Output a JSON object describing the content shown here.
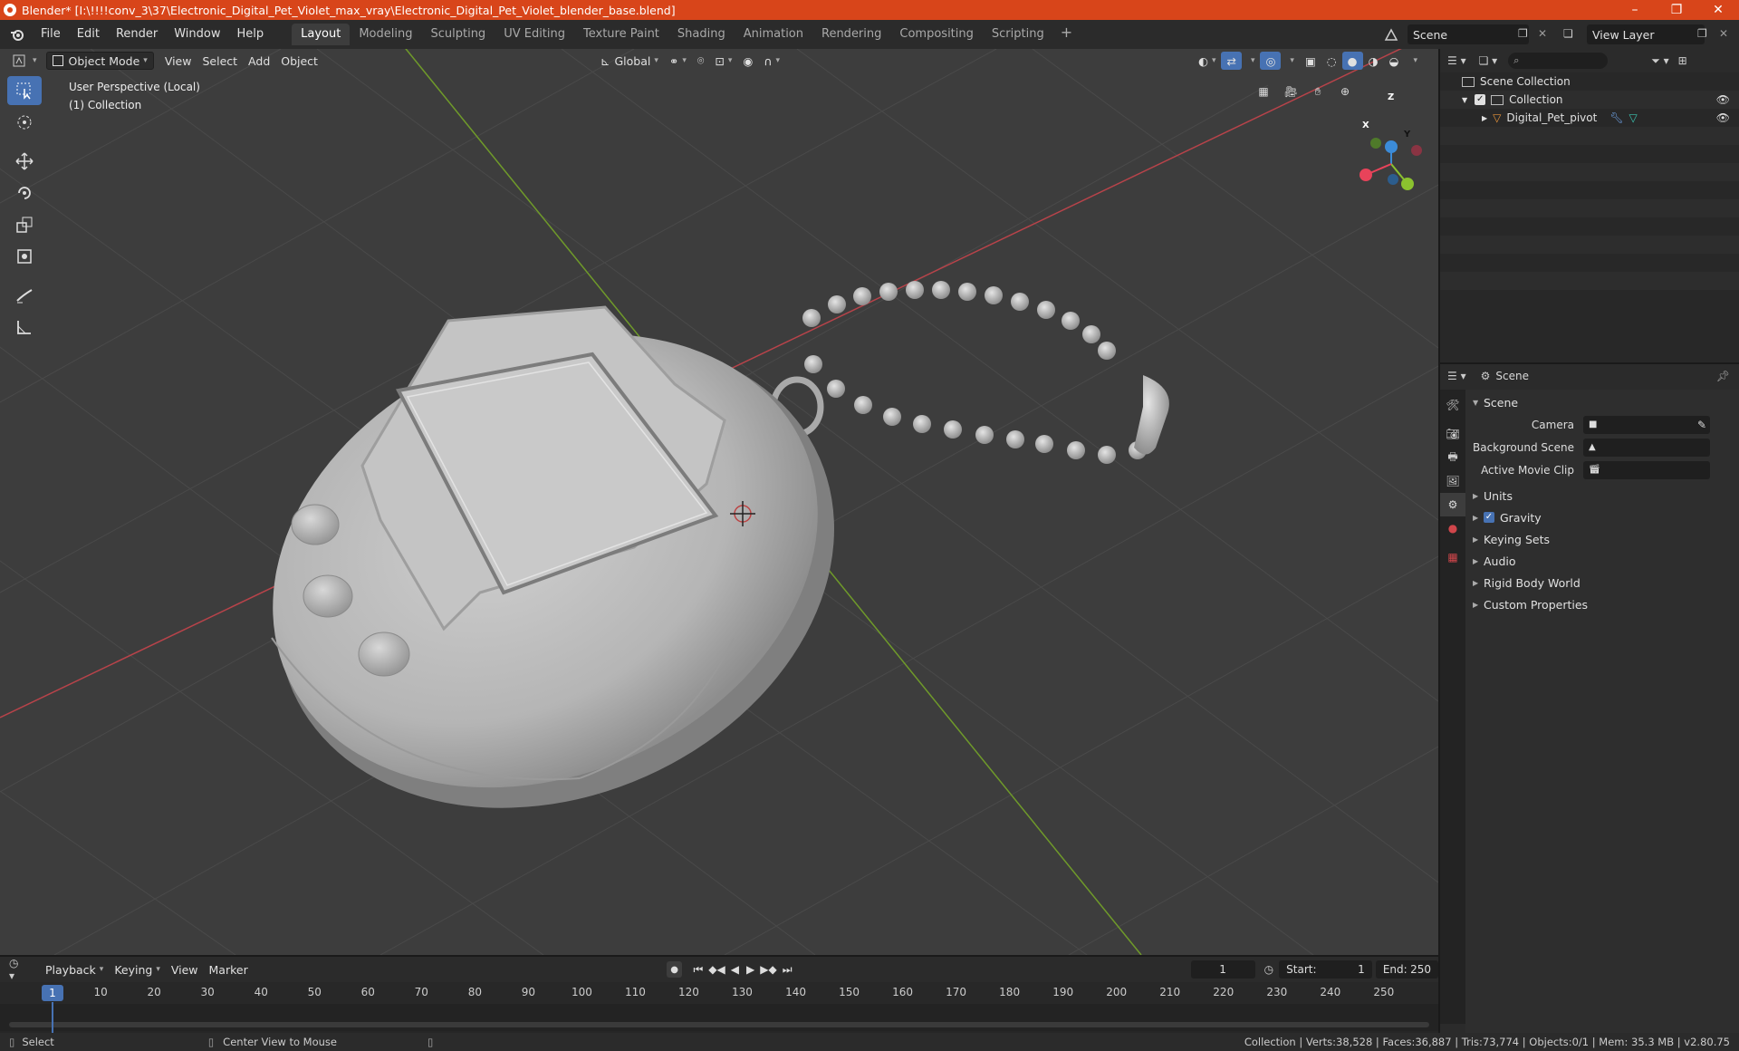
{
  "window": {
    "title": "Blender* [I:\\!!!!conv_3\\37\\Electronic_Digital_Pet_Violet_max_vray\\Electronic_Digital_Pet_Violet_blender_base.blend]",
    "minimize": "–",
    "maximize": "❐",
    "close": "✕"
  },
  "menu": [
    "File",
    "Edit",
    "Render",
    "Window",
    "Help"
  ],
  "workspaces": [
    "Layout",
    "Modeling",
    "Sculpting",
    "UV Editing",
    "Texture Paint",
    "Shading",
    "Animation",
    "Rendering",
    "Compositing",
    "Scripting"
  ],
  "workspace_add": "+",
  "scene_name": "Scene",
  "view_layer": "View Layer",
  "viewport": {
    "mode": "Object Mode",
    "menus": [
      "View",
      "Select",
      "Add",
      "Object"
    ],
    "orientation": "Global",
    "info_line1": "User Perspective (Local)",
    "info_line2": "(1) Collection",
    "gizmo": {
      "x": "X",
      "y": "Y",
      "z": "Z"
    }
  },
  "outliner": {
    "scene_collection": "Scene Collection",
    "collection": "Collection",
    "object": "Digital_Pet_pivot"
  },
  "properties": {
    "context": "Scene",
    "panel_scene": "Scene",
    "camera_label": "Camera",
    "background_scene_label": "Background Scene",
    "active_movie_clip_label": "Active Movie Clip",
    "panels": [
      "Units",
      "Gravity",
      "Keying Sets",
      "Audio",
      "Rigid Body World",
      "Custom Properties"
    ]
  },
  "timeline": {
    "menus": [
      "Playback",
      "Keying",
      "View",
      "Marker"
    ],
    "current_frame": "1",
    "start_label": "Start:",
    "start": "1",
    "end_label": "End:",
    "end": "250",
    "ticks": [
      "1",
      "10",
      "20",
      "30",
      "40",
      "50",
      "60",
      "70",
      "80",
      "90",
      "100",
      "110",
      "120",
      "130",
      "140",
      "150",
      "160",
      "170",
      "180",
      "190",
      "200",
      "210",
      "220",
      "230",
      "240",
      "250"
    ]
  },
  "status": {
    "select": "Select",
    "center": "Center View to Mouse",
    "stats": "Collection | Verts:38,528 | Faces:36,887 | Tris:73,774 | Objects:0/1 | Mem: 35.3 MB | v2.80.75"
  },
  "colors": {
    "titlebar": "#d8451a",
    "accent": "#4772b3",
    "axis_x": "#e8435a",
    "axis_y": "#8bc22f",
    "axis_z": "#3b8bd8"
  }
}
